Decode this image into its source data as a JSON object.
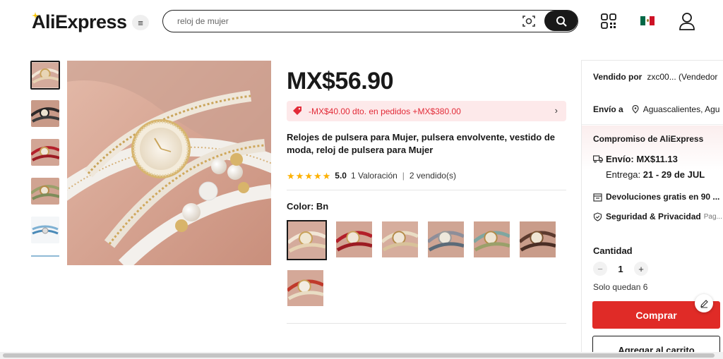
{
  "header": {
    "logo": "AliExpress",
    "search_placeholder": "reloj de mujer"
  },
  "product": {
    "price": "MX$56.90",
    "promo_text": "-MX$40.00 dto. en pedidos +MX$380.00",
    "title": "Relojes de pulsera para Mujer, pulsera envolvente, vestido de moda, reloj de pulsera para Mujer",
    "rating_score": "5.0",
    "rating_count": "1 Valoración",
    "sold": "2 vendido(s)",
    "stars": 5,
    "color_label": "Color: Bn",
    "swatch_count": 7
  },
  "panel": {
    "sold_by_label": "Vendido por",
    "sold_by_value": "zxc00... (Vendedor",
    "ship_to_label": "Envío a",
    "ship_to_value": "Aguascalientes, Agu",
    "commitment_title": "Compromiso de AliExpress",
    "shipping": "Envío: MX$11.13",
    "delivery_label": "Entrega:",
    "delivery_dates": "21 - 29 de JUL",
    "returns": "Devoluciones gratis en 90 ...",
    "security": "Seguridad & Privacidad",
    "security_more": "Pag...",
    "quantity_label": "Cantidad",
    "quantity_value": "1",
    "stock": "Solo quedan 6",
    "buy_label": "Comprar",
    "cart_label": "Agregar al carrito"
  },
  "colors": {
    "brand_red": "#e02b27",
    "promo_red": "#e22b38",
    "star": "#fdb100"
  }
}
